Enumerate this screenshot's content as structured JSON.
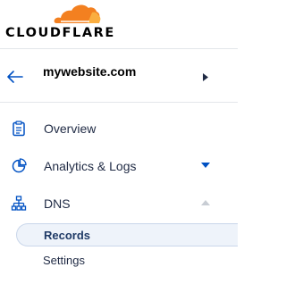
{
  "brand": {
    "wordmark": "CLOUDFLARE",
    "cloud_colors": [
      "#f38020",
      "#faae40"
    ]
  },
  "site": {
    "name": "mywebsite.com",
    "back_icon": "arrow-left-icon",
    "caret_icon": "caret-right-icon"
  },
  "nav": {
    "items": [
      {
        "label": "Overview",
        "icon": "clipboard-icon"
      },
      {
        "label": "Analytics & Logs",
        "icon": "pie-chart-icon",
        "caret": "caret-down-icon"
      },
      {
        "label": "DNS",
        "icon": "sitemap-icon",
        "caret": "caret-up-icon",
        "expanded": true
      }
    ],
    "dns_subitems": [
      {
        "label": "Records",
        "active": true
      },
      {
        "label": "Settings",
        "active": false
      }
    ]
  },
  "colors": {
    "accent": "#0051c3",
    "text": "#1f2a44",
    "active_bg": "#eef3fa"
  }
}
